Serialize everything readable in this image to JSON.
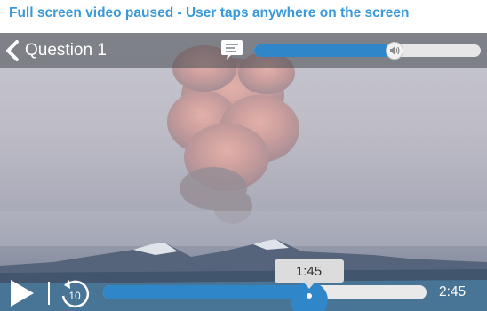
{
  "caption": "Full screen video paused - User taps anywhere on the screen",
  "header": {
    "back_label": "Question 1",
    "icons": {
      "back": "chevron-left-icon",
      "captions": "captions-icon",
      "volume": "speaker-icon"
    }
  },
  "volume": {
    "level": 0.62
  },
  "player": {
    "state": "paused",
    "rewind_seconds": "10",
    "current_time": "1:45",
    "duration": "2:45",
    "progress": 0.636,
    "icons": {
      "play": "play-icon",
      "rewind": "rewind-10-icon"
    }
  },
  "colors": {
    "accent": "#2f86c8",
    "caption_text": "#3a9ad9",
    "track": "#e7e7e7"
  }
}
